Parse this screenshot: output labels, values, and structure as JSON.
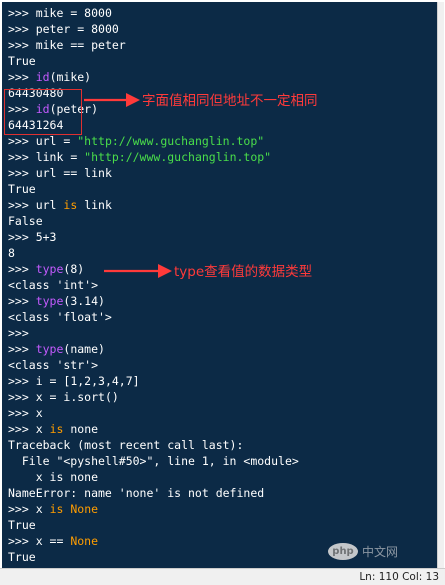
{
  "lines": [
    [
      {
        "t": ">>> ",
        "c": "prompt"
      },
      {
        "t": "mike = 8000",
        "c": "code"
      }
    ],
    [
      {
        "t": ">>> ",
        "c": "prompt"
      },
      {
        "t": "peter = 8000",
        "c": "code"
      }
    ],
    [
      {
        "t": ">>> ",
        "c": "prompt"
      },
      {
        "t": "mike == peter",
        "c": "code"
      }
    ],
    [
      {
        "t": "True",
        "c": "out"
      }
    ],
    [
      {
        "t": ">>> ",
        "c": "prompt"
      },
      {
        "t": "id",
        "c": "bi"
      },
      {
        "t": "(mike)",
        "c": "code"
      }
    ],
    [
      {
        "t": "64430480",
        "c": "out"
      }
    ],
    [
      {
        "t": ">>> ",
        "c": "prompt"
      },
      {
        "t": "id",
        "c": "bi"
      },
      {
        "t": "(peter)",
        "c": "code"
      }
    ],
    [
      {
        "t": "64431264",
        "c": "out"
      }
    ],
    [
      {
        "t": ">>> ",
        "c": "prompt"
      },
      {
        "t": "url = ",
        "c": "code"
      },
      {
        "t": "\"http://www.guchanglin.top\"",
        "c": "str"
      }
    ],
    [
      {
        "t": ">>> ",
        "c": "prompt"
      },
      {
        "t": "link = ",
        "c": "code"
      },
      {
        "t": "\"http://www.guchanglin.top\"",
        "c": "str"
      }
    ],
    [
      {
        "t": ">>> ",
        "c": "prompt"
      },
      {
        "t": "url == link",
        "c": "code"
      }
    ],
    [
      {
        "t": "True",
        "c": "out"
      }
    ],
    [
      {
        "t": ">>> ",
        "c": "prompt"
      },
      {
        "t": "url ",
        "c": "code"
      },
      {
        "t": "is",
        "c": "kw"
      },
      {
        "t": " link",
        "c": "code"
      }
    ],
    [
      {
        "t": "False",
        "c": "out"
      }
    ],
    [
      {
        "t": ">>> ",
        "c": "prompt"
      },
      {
        "t": "5+3",
        "c": "code"
      }
    ],
    [
      {
        "t": "8",
        "c": "out"
      }
    ],
    [
      {
        "t": ">>> ",
        "c": "prompt"
      },
      {
        "t": "type",
        "c": "bi"
      },
      {
        "t": "(8)",
        "c": "code"
      }
    ],
    [
      {
        "t": "<class 'int'>",
        "c": "out"
      }
    ],
    [
      {
        "t": ">>> ",
        "c": "prompt"
      },
      {
        "t": "type",
        "c": "bi"
      },
      {
        "t": "(3.14)",
        "c": "code"
      }
    ],
    [
      {
        "t": "<class 'float'>",
        "c": "out"
      }
    ],
    [
      {
        "t": ">>>",
        "c": "prompt"
      }
    ],
    [
      {
        "t": ">>> ",
        "c": "prompt"
      },
      {
        "t": "type",
        "c": "bi"
      },
      {
        "t": "(name)",
        "c": "code"
      }
    ],
    [
      {
        "t": "<class 'str'>",
        "c": "out"
      }
    ],
    [
      {
        "t": ">>> ",
        "c": "prompt"
      },
      {
        "t": "i = [1,2,3,4,7]",
        "c": "code"
      }
    ],
    [
      {
        "t": ">>> ",
        "c": "prompt"
      },
      {
        "t": "x = i.sort()",
        "c": "code"
      }
    ],
    [
      {
        "t": ">>> ",
        "c": "prompt"
      },
      {
        "t": "x",
        "c": "code"
      }
    ],
    [
      {
        "t": ">>> ",
        "c": "prompt"
      },
      {
        "t": "x ",
        "c": "code"
      },
      {
        "t": "is",
        "c": "kw"
      },
      {
        "t": " none",
        "c": "code"
      }
    ],
    [
      {
        "t": "Traceback (most recent call last):",
        "c": "out"
      }
    ],
    [
      {
        "t": "  File \"<pyshell#50>\", line 1, in <module>",
        "c": "out"
      }
    ],
    [
      {
        "t": "    x is none",
        "c": "out"
      }
    ],
    [
      {
        "t": "NameError: name 'none' is not defined",
        "c": "out"
      }
    ],
    [
      {
        "t": ">>> ",
        "c": "prompt"
      },
      {
        "t": "x ",
        "c": "code"
      },
      {
        "t": "is",
        "c": "kw"
      },
      {
        "t": " ",
        "c": "code"
      },
      {
        "t": "None",
        "c": "kw"
      }
    ],
    [
      {
        "t": "True",
        "c": "out"
      }
    ],
    [
      {
        "t": ">>> ",
        "c": "prompt"
      },
      {
        "t": "x == ",
        "c": "code"
      },
      {
        "t": "None",
        "c": "kw"
      }
    ],
    [
      {
        "t": "True",
        "c": "out"
      }
    ]
  ],
  "annotations": {
    "address": "字面值相同但地址不一定相同",
    "type": "type查看值的数据类型"
  },
  "status": {
    "text": "Ln: 110   Col: 13"
  },
  "watermark": {
    "logo": "php",
    "text": "中文网"
  },
  "colors": {
    "background": "#0c2a46",
    "keyword": "#ff9d00",
    "builtin": "#c55aff",
    "string": "#4ade4a",
    "annotation": "#ff3a3a"
  }
}
